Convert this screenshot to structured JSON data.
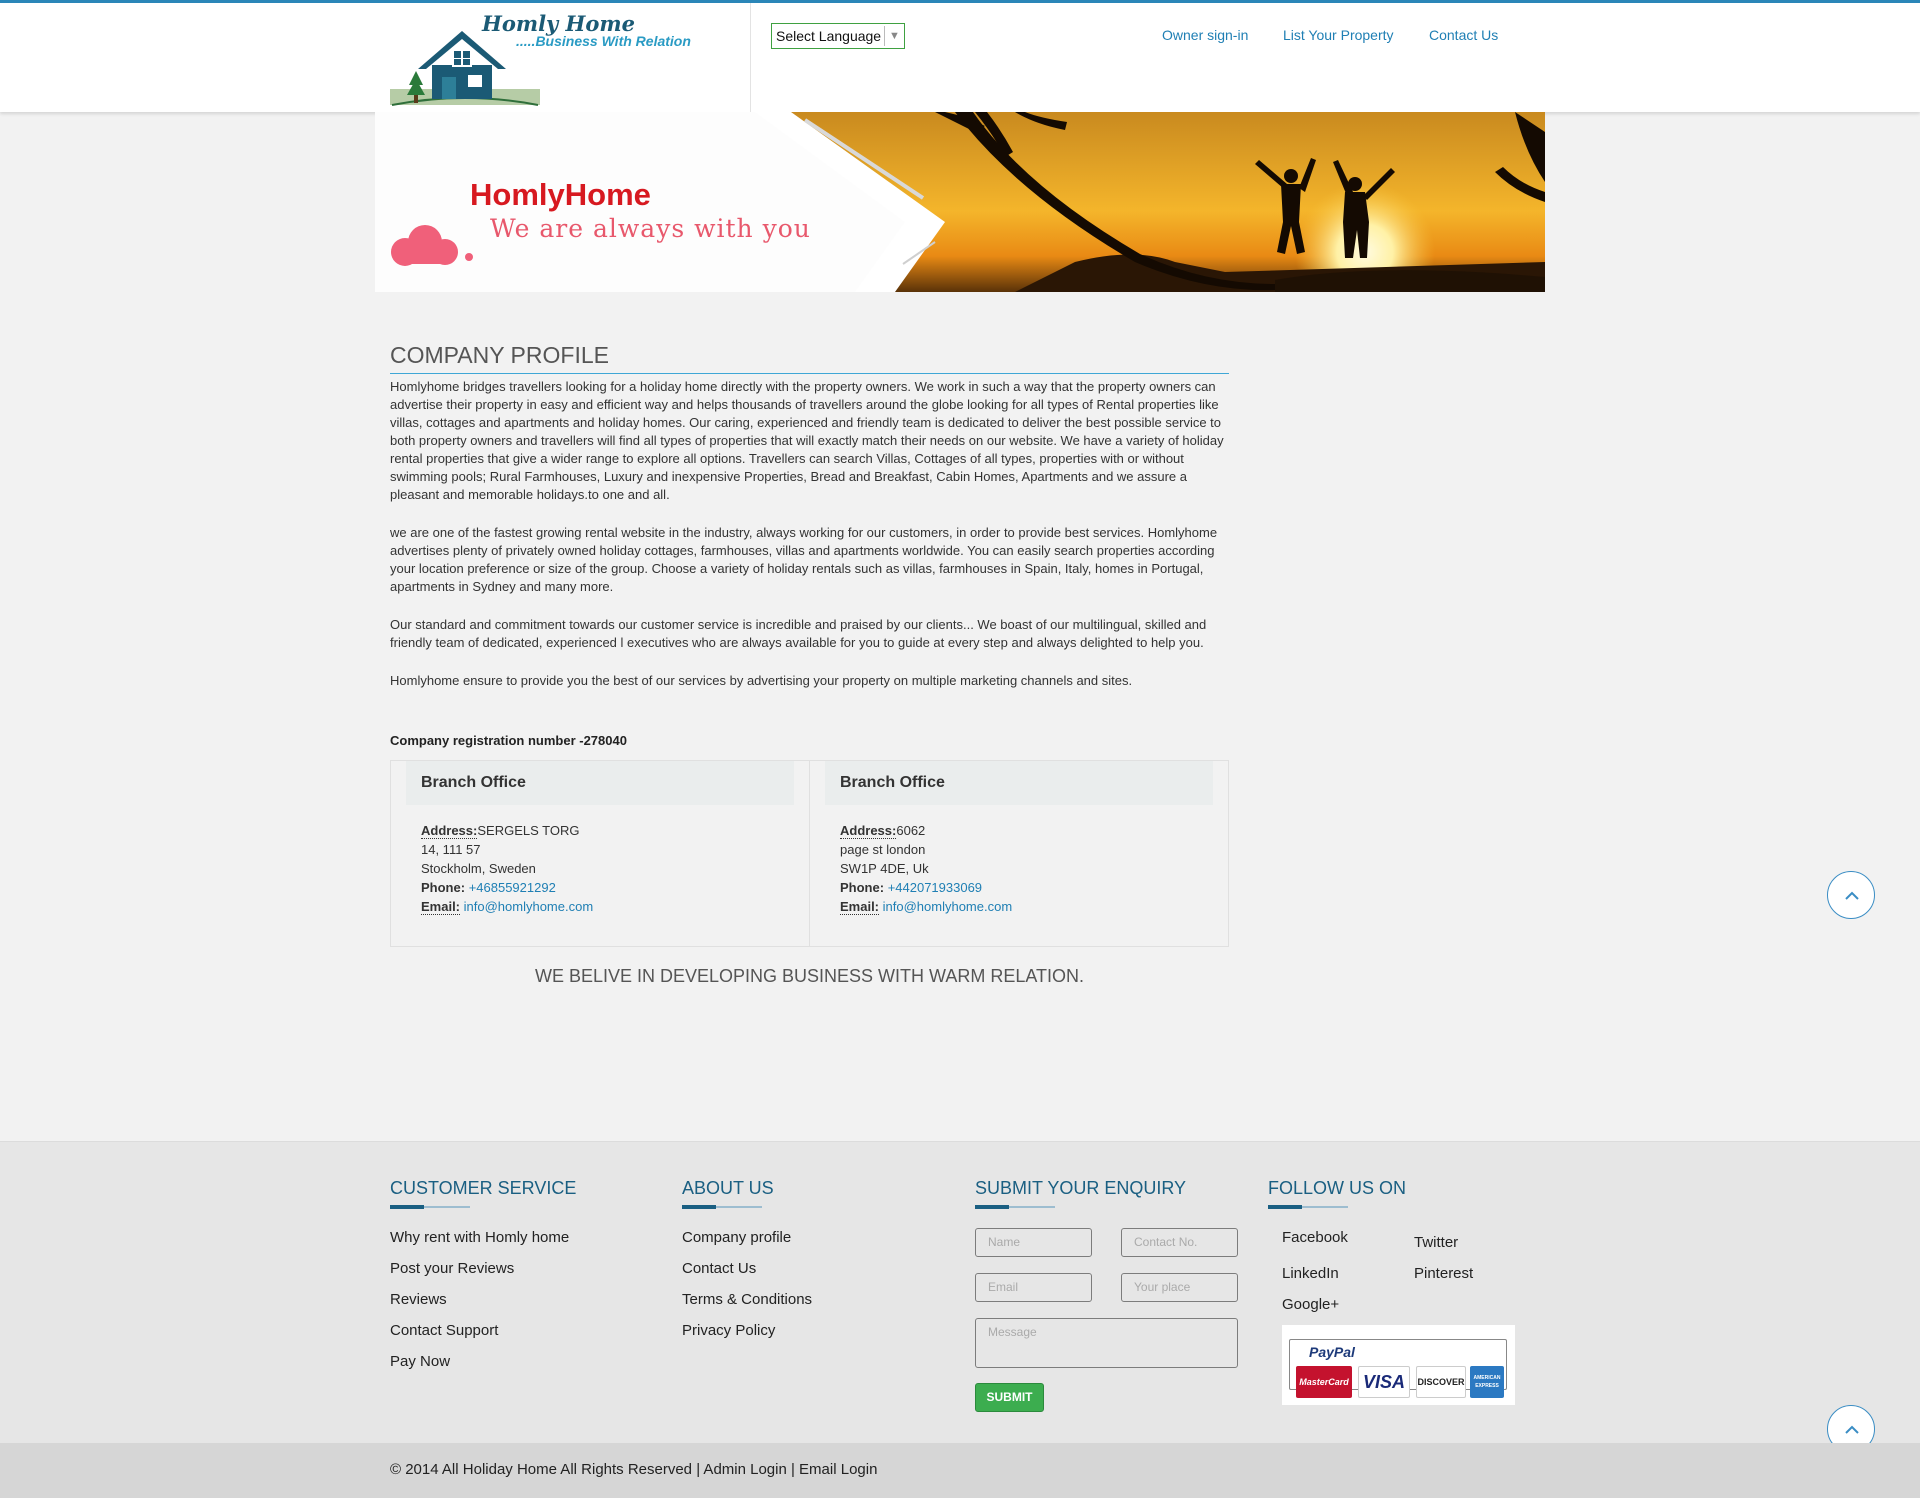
{
  "header": {
    "logo_title": "Homly Home",
    "logo_tagline": ".....Business With Relation",
    "language_select": "Select Language",
    "nav": [
      "Owner sign-in",
      "List Your Property",
      "Contact Us"
    ]
  },
  "banner": {
    "title": "HomlyHome",
    "subtitle": "We are always with you"
  },
  "profile": {
    "title": "COMPANY PROFILE",
    "paragraphs": [
      "Homlyhome bridges travellers looking for a holiday home directly with the property owners. We work in such a way that the property owners can advertise their property in easy and efficient way and helps thousands of travellers around the globe looking for all types of Rental properties like villas, cottages and apartments and holiday homes. Our caring, experienced and friendly team is dedicated to deliver the best possible service to both property owners and travellers will find all types of properties that will exactly match their needs on our website. We have a variety of holiday rental properties that give a wider range to explore all options. Travellers can search Villas, Cottages of all types, properties with or without swimming pools; Rural Farmhouses, Luxury and inexpensive Properties, Bread and Breakfast, Cabin Homes, Apartments and we assure a pleasant and memorable holidays.to one and all.",
      "we are one of the fastest growing rental website in the industry, always working for our customers, in order to provide best services. Homlyhome advertises plenty of privately owned holiday cottages, farmhouses, villas and apartments worldwide. You can easily search properties according your location preference or size of the group. Choose a variety of holiday rentals such as villas, farmhouses in Spain, Italy, homes in Portugal, apartments in Sydney and many more.",
      "Our standard and commitment towards our customer service is incredible and praised by our clients... We boast of our multilingual, skilled and friendly team of dedicated, experienced l executives who are always available for you to guide at every step and always delighted to help you.",
      "Homlyhome ensure to provide you the best of our services by advertising your property on multiple marketing channels and sites."
    ],
    "registration": "Company registration number -278040",
    "offices": [
      {
        "heading": "Branch Office",
        "address_label": "Address:",
        "address_1": "SERGELS TORG",
        "address_2": "14, 111 57",
        "address_3": "Stockholm, Sweden",
        "phone_label": "Phone:",
        "phone": "+46855921292",
        "email_label": "Email:",
        "email": "info@homlyhome.com"
      },
      {
        "heading": "Branch Office",
        "address_label": "Address:",
        "address_1": "6062",
        "address_2": "page st london",
        "address_3": "SW1P 4DE, Uk",
        "phone_label": "Phone:",
        "phone": "+442071933069",
        "email_label": "Email:",
        "email": "info@homlyhome.com"
      }
    ],
    "motto": "WE BELIVE IN DEVELOPING BUSINESS WITH WARM RELATION."
  },
  "footer": {
    "customer_service": {
      "heading": "CUSTOMER SERVICE",
      "links": [
        "Why rent with Homly home",
        "Post your Reviews",
        "Reviews",
        "Contact Support",
        "Pay Now"
      ]
    },
    "about": {
      "heading": "ABOUT US",
      "links": [
        "Company profile",
        "Contact Us",
        "Terms & Conditions",
        "Privacy Policy"
      ]
    },
    "enquiry": {
      "heading": "SUBMIT YOUR ENQUIRY",
      "name_placeholder": "Name",
      "contact_placeholder": "Contact No.",
      "email_placeholder": "Email",
      "place_placeholder": "Your place",
      "message_placeholder": "Message",
      "submit_label": "SUBMIT"
    },
    "follow": {
      "heading": "FOLLOW US ON",
      "links": [
        "Facebook",
        "Twitter",
        "LinkedIn",
        "Pinterest",
        "Google+"
      ]
    },
    "payment": {
      "paypal": "PayPal",
      "cards": [
        "MasterCard",
        "VISA",
        "DISCOVER",
        "AMERICAN EXPRESS"
      ]
    },
    "copyright": "© 2014 All Holiday Home All Rights Reserved | Admin Login | Email Login"
  },
  "colors": {
    "accent_blue": "#1f7fb4",
    "heading_blue": "#1a5f82",
    "banner_red": "#d71920",
    "submit_green": "#3cad4f"
  }
}
